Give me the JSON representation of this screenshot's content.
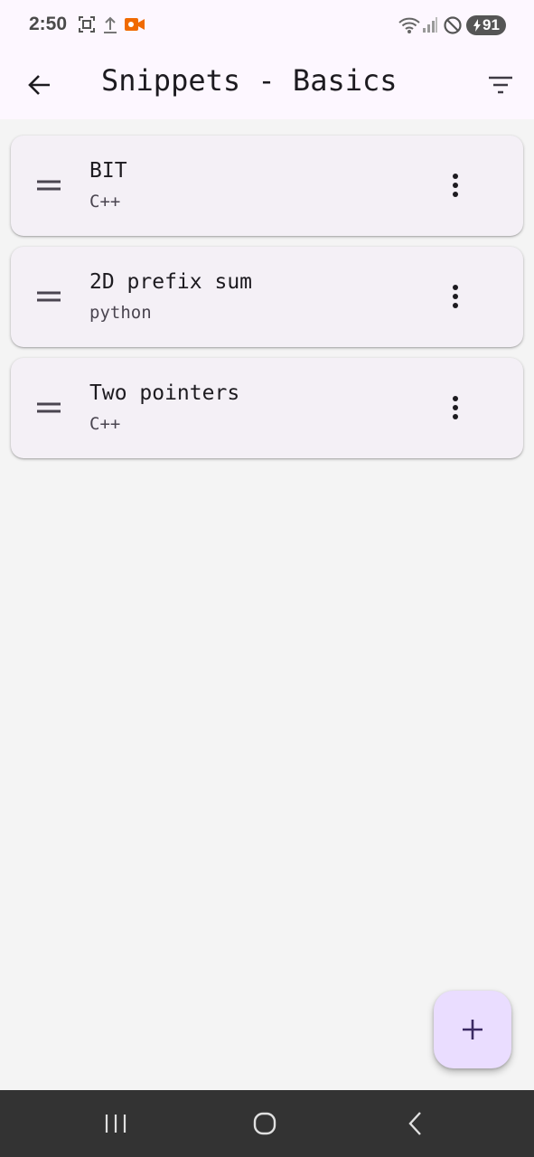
{
  "status_bar": {
    "time": "2:50",
    "battery": "91",
    "icons": [
      "screenshot-icon",
      "upload-icon",
      "video-record-icon",
      "wifi-icon",
      "signal-icon",
      "do-not-disturb-icon",
      "battery-charging-icon"
    ],
    "colors": {
      "record": "#f06a00"
    }
  },
  "app_bar": {
    "title": "Snippets - Basics",
    "back_icon": "arrow-back-icon",
    "filter_icon": "filter-icon"
  },
  "snippets": [
    {
      "title": "BIT",
      "language": "C++"
    },
    {
      "title": "2D prefix sum",
      "language": "python"
    },
    {
      "title": "Two pointers",
      "language": "C++"
    }
  ],
  "fab": {
    "icon": "plus-icon",
    "color": "#eaddff"
  },
  "colors": {
    "background": "#f4f4f4",
    "card": "#f4f0f6",
    "app_bar": "#fdf7ff",
    "nav_bar": "#333333"
  }
}
